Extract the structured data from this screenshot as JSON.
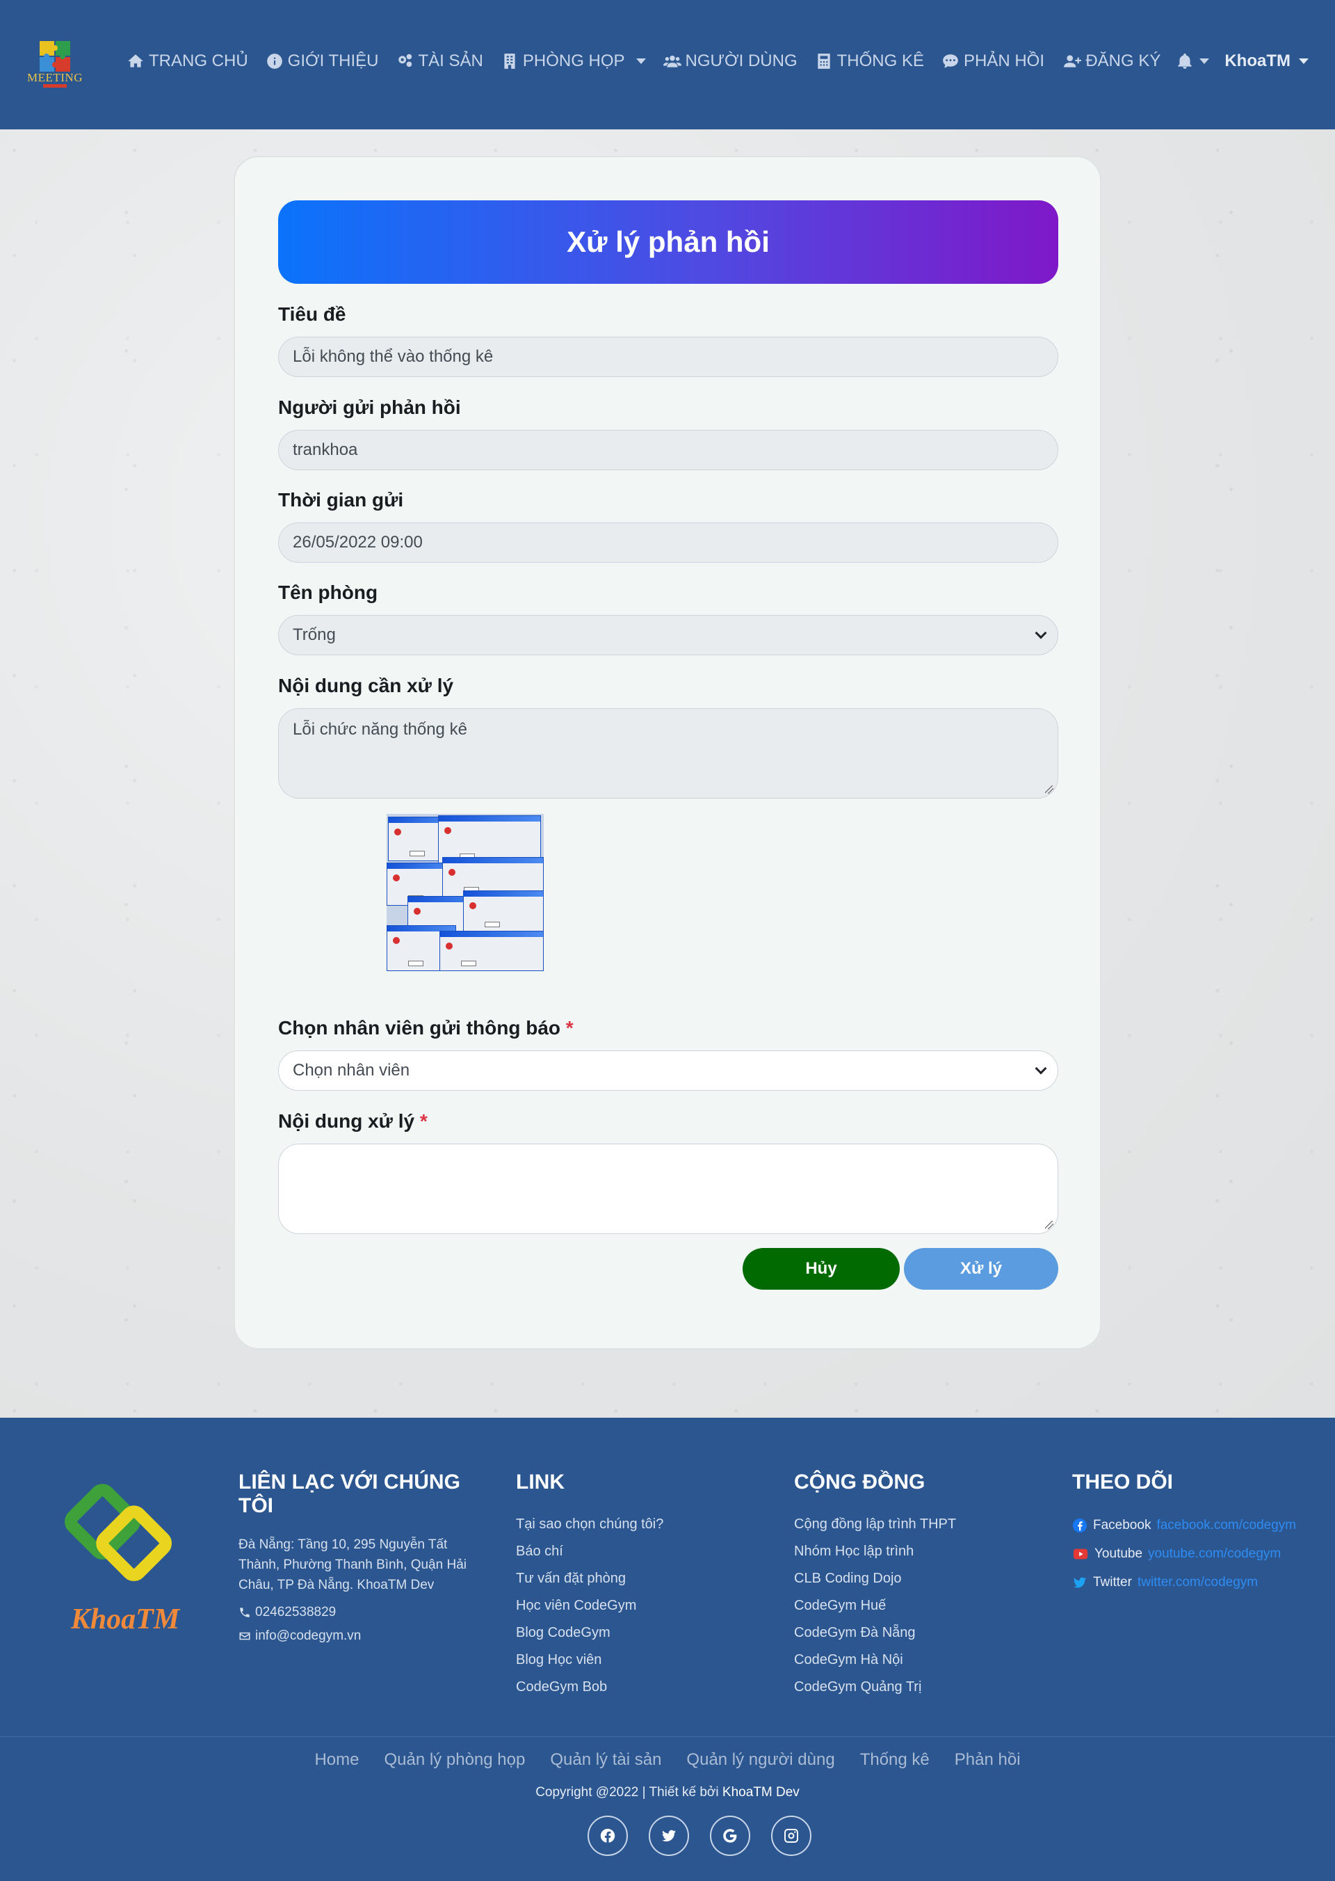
{
  "brand": {
    "logo_text": "MEETING"
  },
  "nav": {
    "home": "TRANG CHỦ",
    "about": "GIỚI THIỆU",
    "assets": "TÀI SẢN",
    "rooms": "PHÒNG HỌP",
    "users": "NGƯỜI DÙNG",
    "stats": "THỐNG KÊ",
    "feedback": "PHẢN HỒI",
    "register": "ĐĂNG KÝ",
    "user_name": "KhoaTM"
  },
  "form": {
    "header": "Xử lý phản hồi",
    "title_label": "Tiêu đề",
    "title_value": "Lỗi không thể vào thống kê",
    "sender_label": "Người gửi phản hồi",
    "sender_value": "trankhoa",
    "time_label": "Thời gian gửi",
    "time_value": "26/05/2022 09:00",
    "room_label": "Tên phòng",
    "room_value": "Trống",
    "content_label": "Nội dung cần xử lý",
    "content_value": "Lỗi chức năng thống kê",
    "staff_label": "Chọn nhân viên gửi thông báo",
    "staff_placeholder": "Chọn nhân viên",
    "process_label": "Nội dung xử lý",
    "process_value": "",
    "required_mark": "*",
    "cancel_button": "Hủy",
    "submit_button": "Xử lý"
  },
  "footer": {
    "logo_text": "KhoaTM",
    "contact_title": "LIÊN LẠC VỚI CHÚNG TÔI",
    "contact_address": "Đà Nẵng: Tầng 10, 295 Nguyễn Tất Thành, Phường Thanh Bình, Quận Hải Châu, TP Đà Nẵng. KhoaTM Dev",
    "contact_phone": "02462538829",
    "contact_email": "info@codegym.vn",
    "link_title": "LINK",
    "links": [
      "Tại sao chọn chúng tôi?",
      "Báo chí",
      "Tư vấn đặt phòng",
      "Học viên CodeGym",
      "Blog CodeGym",
      "Blog Học viên",
      "CodeGym Bob"
    ],
    "community_title": "CỘNG ĐỒNG",
    "community": [
      "Cộng đồng lập trình THPT",
      "Nhóm Học lập trình",
      "CLB Coding Dojo",
      "CodeGym Huế",
      "CodeGym Đà Nẵng",
      "CodeGym Hà Nội",
      "CodeGym Quảng Trị"
    ],
    "follow_title": "THEO DÕI",
    "follow": [
      {
        "name": "Facebook",
        "link": "facebook.com/codegym"
      },
      {
        "name": "Youtube",
        "link": "youtube.com/codegym"
      },
      {
        "name": "Twitter",
        "link": "twitter.com/codegym"
      }
    ],
    "bottom_nav": [
      "Home",
      "Quản lý phòng họp",
      "Quản lý tài sản",
      "Quản lý người dùng",
      "Thống kê",
      "Phản hồi"
    ],
    "copyright_prefix": "Copyright @2022 | Thiết kế bởi ",
    "copyright_author": "KhoaTM Dev"
  },
  "colors": {
    "navbar": "#2c568f",
    "header_gradient_start": "#0b73fb",
    "header_gradient_end": "#7f18c8",
    "cancel_button": "#016a00",
    "submit_button": "#5b9be0",
    "required": "#dc3545",
    "link": "#2e8cf3"
  },
  "icons": {
    "home": "home-icon",
    "about": "info-circle-icon",
    "assets": "gears-icon",
    "rooms": "building-icon",
    "users": "users-icon",
    "stats": "calculator-icon",
    "feedback": "comment-icon",
    "register": "user-plus-icon",
    "bell": "bell-icon",
    "phone": "phone-icon",
    "email": "envelope-icon",
    "facebook": "facebook-icon",
    "youtube": "youtube-icon",
    "twitter": "twitter-icon",
    "google": "google-icon",
    "instagram": "instagram-icon"
  }
}
